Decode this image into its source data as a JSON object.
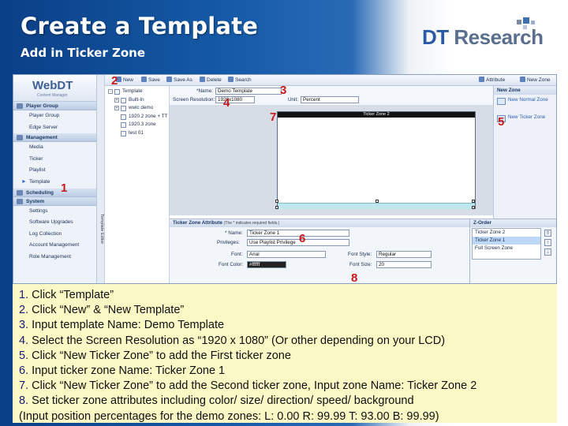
{
  "slide": {
    "title": "Create a Template",
    "subtitle": "Add in Ticker Zone",
    "logo_prefix": "DT",
    "logo_word": "Research"
  },
  "app": {
    "brand": "WebDT",
    "brand_sub": "Content Manager",
    "vertical_label": "Template Editor",
    "toolbar": {
      "new": "New",
      "save": "Save",
      "save_as": "Save As",
      "delete": "Delete",
      "search": "Search",
      "attribute": "Attribute",
      "new_zone": "New Zone"
    },
    "sidebar": {
      "groups": [
        {
          "label": "Player Group",
          "items": [
            "Player Group",
            "Edge Server"
          ]
        },
        {
          "label": "Management",
          "items": [
            "Media",
            "Ticker",
            "Playlist",
            "Template"
          ]
        },
        {
          "label": "Scheduling",
          "items": []
        },
        {
          "label": "System",
          "items": [
            "Settings",
            "Software Upgrades",
            "Log Collection",
            "Account Management",
            "Role Management"
          ]
        }
      ]
    },
    "tree": {
      "root": "Template",
      "items": [
        "Built-In",
        "wwlc demo",
        "1920.2 zone + TT",
        "1920.3 zone",
        "test 01"
      ]
    },
    "form": {
      "name_label": "*Name:",
      "name_value": "Demo Template",
      "resolution_label": "Screen Resolution:",
      "resolution_value": "1920x1080",
      "unit_label": "Unit:",
      "unit_value": "Percent"
    },
    "canvas": {
      "ticker2_label": "Ticker Zone 2"
    },
    "new_zone_menu": {
      "header": "New Zone",
      "items": [
        "New Normal Zone",
        "New Ticker Zone"
      ]
    },
    "attributes": {
      "title": "Ticker Zone Attribute",
      "note": "(The * indicates required fields.)",
      "name_label": "* Name:",
      "name_value": "Ticker Zone 1",
      "privileges_label": "Privileges:",
      "privileges_value": "Use Playlist Privilege",
      "font_label": "Font:",
      "font_value": "Arial",
      "font_style_label": "Font Style:",
      "font_style_value": "Regular",
      "font_color_label": "Font Color:",
      "font_color_value": "#ffffff",
      "font_size_label": "Font Size:",
      "font_size_value": "20"
    },
    "zorder": {
      "title": "Z-Order",
      "items": [
        "Ticker Zone 2",
        "Ticker Zone 1",
        "Full Screen Zone"
      ],
      "selected_index": 1
    }
  },
  "callouts": [
    "1",
    "2",
    "3",
    "4",
    "5",
    "6",
    "7",
    "8"
  ],
  "steps": [
    {
      "num": "1.",
      "text": "Click “Template”"
    },
    {
      "num": "2.",
      "text": "Click “New” & “New Template”"
    },
    {
      "num": "3.",
      "text": "Input template Name: Demo Template"
    },
    {
      "num": "4.",
      "text": "Select the Screen Resolution as “1920 x 1080” (Or other depending on your LCD)"
    },
    {
      "num": "5.",
      "text": "Click “New Ticker Zone” to add the First ticker zone"
    },
    {
      "num": "6.",
      "text": "Input ticker zone Name: Ticker Zone 1"
    },
    {
      "num": "7.",
      "text": "Click “New Ticker Zone” to add the Second ticker zone, Input zone Name: Ticker Zone 2"
    },
    {
      "num": "8.",
      "text": "Set ticker zone attributes including color/ size/ direction/ speed/ background"
    },
    {
      "num": "",
      "text": "(Input position percentages for the demo zones: L: 0.00 R: 99.99 T: 93.00 B: 99.99)"
    }
  ],
  "colors": {
    "header_blue": "#0a3f86",
    "callout_red": "#c81818",
    "steps_background": "#faf8c4"
  }
}
